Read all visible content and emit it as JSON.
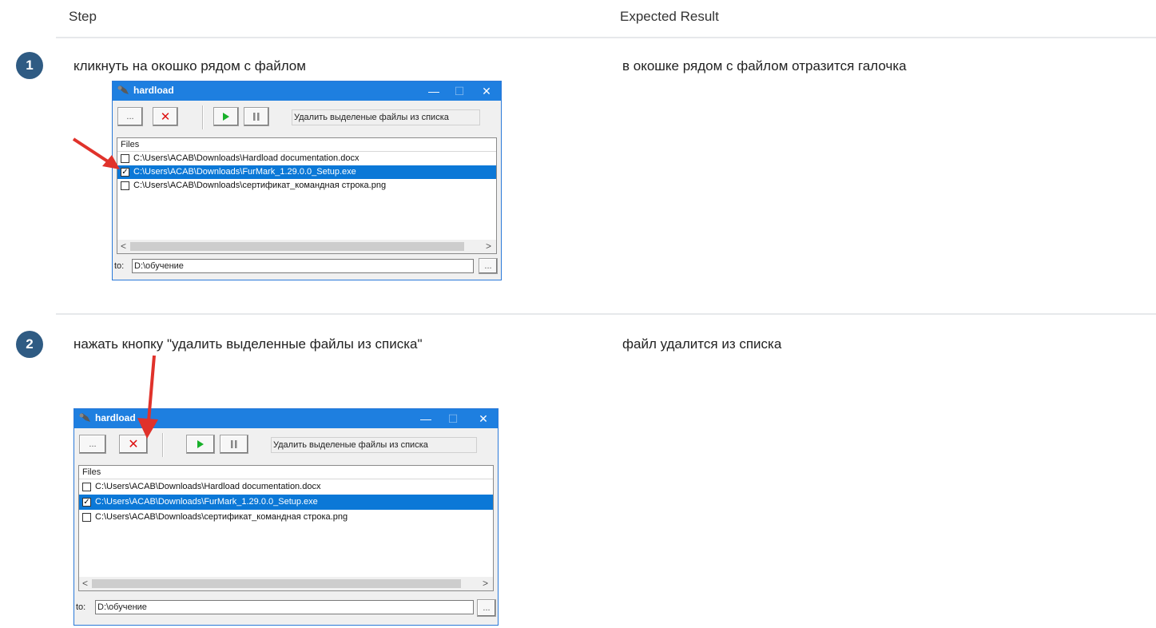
{
  "header": {
    "step_col": "Step",
    "expected_col": "Expected Result"
  },
  "steps": [
    {
      "number": "1",
      "step_text": "кликнуть на окошко рядом с файлом",
      "expected_text": "в окошке рядом с файлом отразится галочка"
    },
    {
      "number": "2",
      "step_text": "нажать кнопку \"удалить выделенные файлы из списка\"",
      "expected_text": "файл удалится из списка"
    }
  ],
  "window": {
    "title": "hardload",
    "browse_label": "...",
    "delete_glyph": "✕",
    "status_text": "Удалить выделеные файлы из списка",
    "list_header": "Files",
    "files": [
      {
        "path": "C:\\Users\\ACAB\\Downloads\\Hardload documentation.docx",
        "checked": false,
        "selected": false
      },
      {
        "path": "C:\\Users\\ACAB\\Downloads\\FurMark_1.29.0.0_Setup.exe",
        "checked": true,
        "selected": true
      },
      {
        "path": "C:\\Users\\ACAB\\Downloads\\сертификат_командная строка.png",
        "checked": false,
        "selected": false
      }
    ],
    "to_label": "to:",
    "to_value": "D:\\обучение",
    "to_browse_label": "..."
  },
  "colors": {
    "badge": "#2f5b83",
    "titlebar": "#1e7fe0",
    "selection": "#0b78d7",
    "arrow": "#e0322b"
  },
  "icons": [
    "app-icon",
    "minimize-icon",
    "maximize-icon",
    "close-icon",
    "delete-icon",
    "play-icon",
    "pause-icon",
    "scroll-left-icon",
    "scroll-right-icon",
    "checkbox-icon"
  ]
}
